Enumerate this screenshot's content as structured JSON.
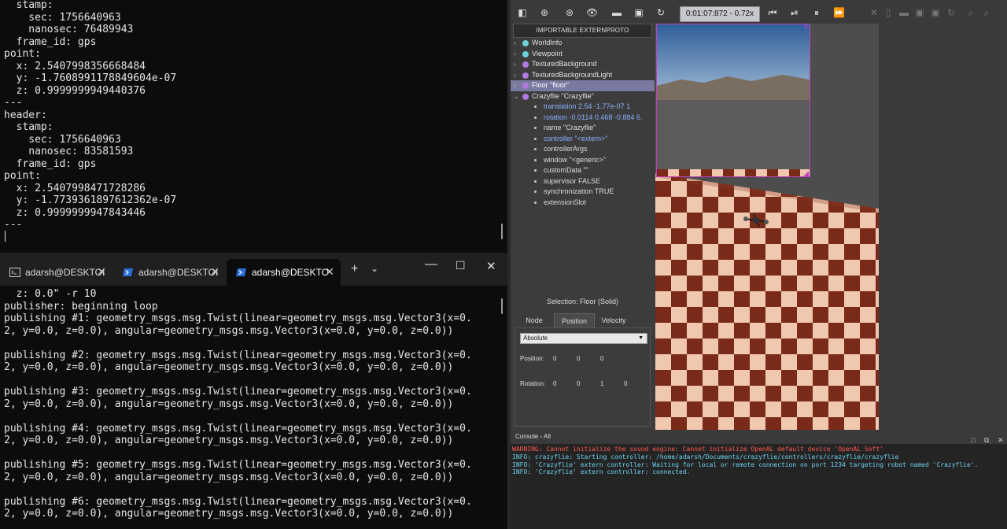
{
  "top_terminal": {
    "lines": [
      "  stamp:",
      "    sec: 1756640963",
      "    nanosec: 76489943",
      "  frame_id: gps",
      "point:",
      "  x: 2.5407998356668484",
      "  y: -1.7608991178849604e-07",
      "  z: 0.9999999949440376",
      "---",
      "header:",
      "  stamp:",
      "    sec: 1756640963",
      "    nanosec: 83581593",
      "  frame_id: gps",
      "point:",
      "  x: 2.5407998471728286",
      "  y: -1.7739361897612362e-07",
      "  z: 0.9999999947843446",
      "---"
    ]
  },
  "tabs": [
    {
      "label": "adarsh@DESKTOI",
      "icon": "terminal-icon"
    },
    {
      "label": "adarsh@DESKTOI",
      "icon": "powershell-icon"
    },
    {
      "label": "adarsh@DESKTO",
      "icon": "powershell-icon"
    }
  ],
  "bottom_terminal": {
    "lines": [
      "  z: 0.0\" -r 10",
      "publisher: beginning loop",
      "publishing #1: geometry_msgs.msg.Twist(linear=geometry_msgs.msg.Vector3(x=0.",
      "2, y=0.0, z=0.0), angular=geometry_msgs.msg.Vector3(x=0.0, y=0.0, z=0.0))",
      "",
      "publishing #2: geometry_msgs.msg.Twist(linear=geometry_msgs.msg.Vector3(x=0.",
      "2, y=0.0, z=0.0), angular=geometry_msgs.msg.Vector3(x=0.0, y=0.0, z=0.0))",
      "",
      "publishing #3: geometry_msgs.msg.Twist(linear=geometry_msgs.msg.Vector3(x=0.",
      "2, y=0.0, z=0.0), angular=geometry_msgs.msg.Vector3(x=0.0, y=0.0, z=0.0))",
      "",
      "publishing #4: geometry_msgs.msg.Twist(linear=geometry_msgs.msg.Vector3(x=0.",
      "2, y=0.0, z=0.0), angular=geometry_msgs.msg.Vector3(x=0.0, y=0.0, z=0.0))",
      "",
      "publishing #5: geometry_msgs.msg.Twist(linear=geometry_msgs.msg.Vector3(x=0.",
      "2, y=0.0, z=0.0), angular=geometry_msgs.msg.Vector3(x=0.0, y=0.0, z=0.0))",
      "",
      "publishing #6: geometry_msgs.msg.Twist(linear=geometry_msgs.msg.Vector3(x=0.",
      "2, y=0.0, z=0.0), angular=geometry_msgs.msg.Vector3(x=0.0, y=0.0, z=0.0))"
    ]
  },
  "webots": {
    "time_display": "0:01:07:872  -  0.72x",
    "importable_button": "IMPORTABLE EXTERNPROTO",
    "scene_tree": [
      {
        "label": "WorldInfo",
        "color": "#6fd0d8",
        "selected": false,
        "expanded": false
      },
      {
        "label": "Viewpoint",
        "color": "#6fd0d8",
        "selected": false,
        "expanded": false
      },
      {
        "label": "TexturedBackground",
        "color": "#b07ae0",
        "selected": false,
        "expanded": false
      },
      {
        "label": "TexturedBackgroundLight",
        "color": "#b07ae0",
        "selected": false,
        "expanded": false
      },
      {
        "label": "Floor \"floor\"",
        "color": "#b07ae0",
        "selected": true,
        "expanded": false
      },
      {
        "label": "Crazyflie \"Crazyflie\"",
        "color": "#b07ae0",
        "selected": false,
        "expanded": true
      }
    ],
    "crazyflie_fields": [
      {
        "label": "translation 2.54 -1.77e-07 1",
        "highlight": true
      },
      {
        "label": "rotation -0.0114 0.468 -0.884 6.",
        "highlight": true
      },
      {
        "label": "name \"Crazyflie\"",
        "highlight": false
      },
      {
        "label": "controller \"<extern>\"",
        "highlight": true
      },
      {
        "label": "controllerArgs",
        "highlight": false
      },
      {
        "label": "window \"<generic>\"",
        "highlight": false
      },
      {
        "label": "customData \"\"",
        "highlight": false
      },
      {
        "label": "supervisor FALSE",
        "highlight": false
      },
      {
        "label": "synchronization TRUE",
        "highlight": false
      },
      {
        "label": "extensionSlot",
        "highlight": false
      }
    ],
    "field_editor": {
      "title": "Selection: Floor (Solid)",
      "tabs": [
        "Node",
        "Position",
        "Velocity"
      ],
      "active_tab": "Position",
      "frame_select": "Absolute",
      "position_label": "Position:",
      "position": [
        "0",
        "0",
        "0"
      ],
      "rotation_label": "Rotation:",
      "rotation": [
        "0",
        "0",
        "1",
        "0"
      ]
    },
    "console": {
      "title": "Console - All",
      "lines": [
        {
          "type": "warning",
          "text": "WARNING: Cannot initialize the sound engine: Cannot initialize OpenAL default device 'OpenAL Soft'"
        },
        {
          "type": "info",
          "text": "INFO: crazyflie: Starting controller: /home/adarsh/Documents/crazyflie/controllers/crazyflie/crazyflie"
        },
        {
          "type": "info",
          "text": "INFO: 'Crazyflie' extern controller: Waiting for local or remote connection on port 1234 targeting robot named 'Crazyflie'."
        },
        {
          "type": "info",
          "text": "INFO: 'Crazyflie' extern controller: connected."
        }
      ]
    },
    "colors": {
      "warning": "#ff5a50",
      "info": "#6cd0f0",
      "floor_dark": "#7a2a18",
      "floor_light": "#f0c8b0",
      "selection": "#7a7aa0",
      "overlay_border": "#c040c0"
    }
  }
}
